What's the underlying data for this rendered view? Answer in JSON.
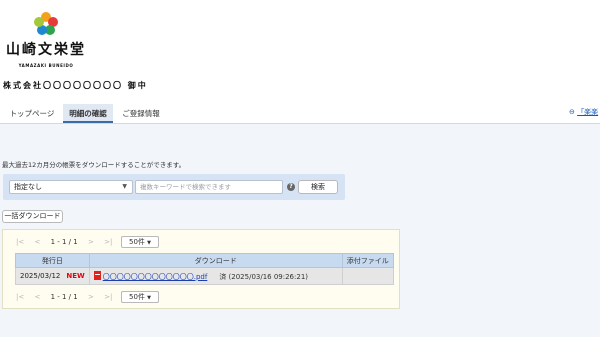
{
  "logo": {
    "name_jp": "山崎文栄堂",
    "name_en": "YAMAZAKI BUNEIDO"
  },
  "customer_label": "株式会社〇〇〇〇〇〇〇〇 御中",
  "nav": {
    "tabs": [
      {
        "label": "トップページ",
        "active": false
      },
      {
        "label": "明細の確認",
        "active": true
      },
      {
        "label": "ご登録情報",
        "active": false
      }
    ],
    "right_link": "「楽楽"
  },
  "description": "最大過去12カ月分の帳票をダウンロードすることができます。",
  "search": {
    "selected": "指定なし",
    "keyword_placeholder": "複数キーワードで検索できます",
    "help": "?",
    "button": "検索"
  },
  "bulk_download_label": "一括ダウンロード",
  "pager": {
    "first": "|<",
    "prev": "<",
    "range": "1 - 1 / 1",
    "next": ">",
    "last": ">|",
    "per_page": "50件"
  },
  "table": {
    "headers": [
      "発行日",
      "ダウンロード",
      "添付ファイル"
    ],
    "rows": [
      {
        "date": "2025/03/12",
        "badge": "NEW",
        "file": "〇〇〇〇〇〇〇〇〇〇〇〇〇.pdf",
        "status": "済 (2025/03/16 09:26:21)",
        "attachment": ""
      }
    ]
  },
  "colors": {
    "accent": "#3b6ca8",
    "link": "#1a56b8",
    "new_badge": "#e60012",
    "search_bg": "#d5e3f4",
    "table_header": "#c7daf0"
  }
}
